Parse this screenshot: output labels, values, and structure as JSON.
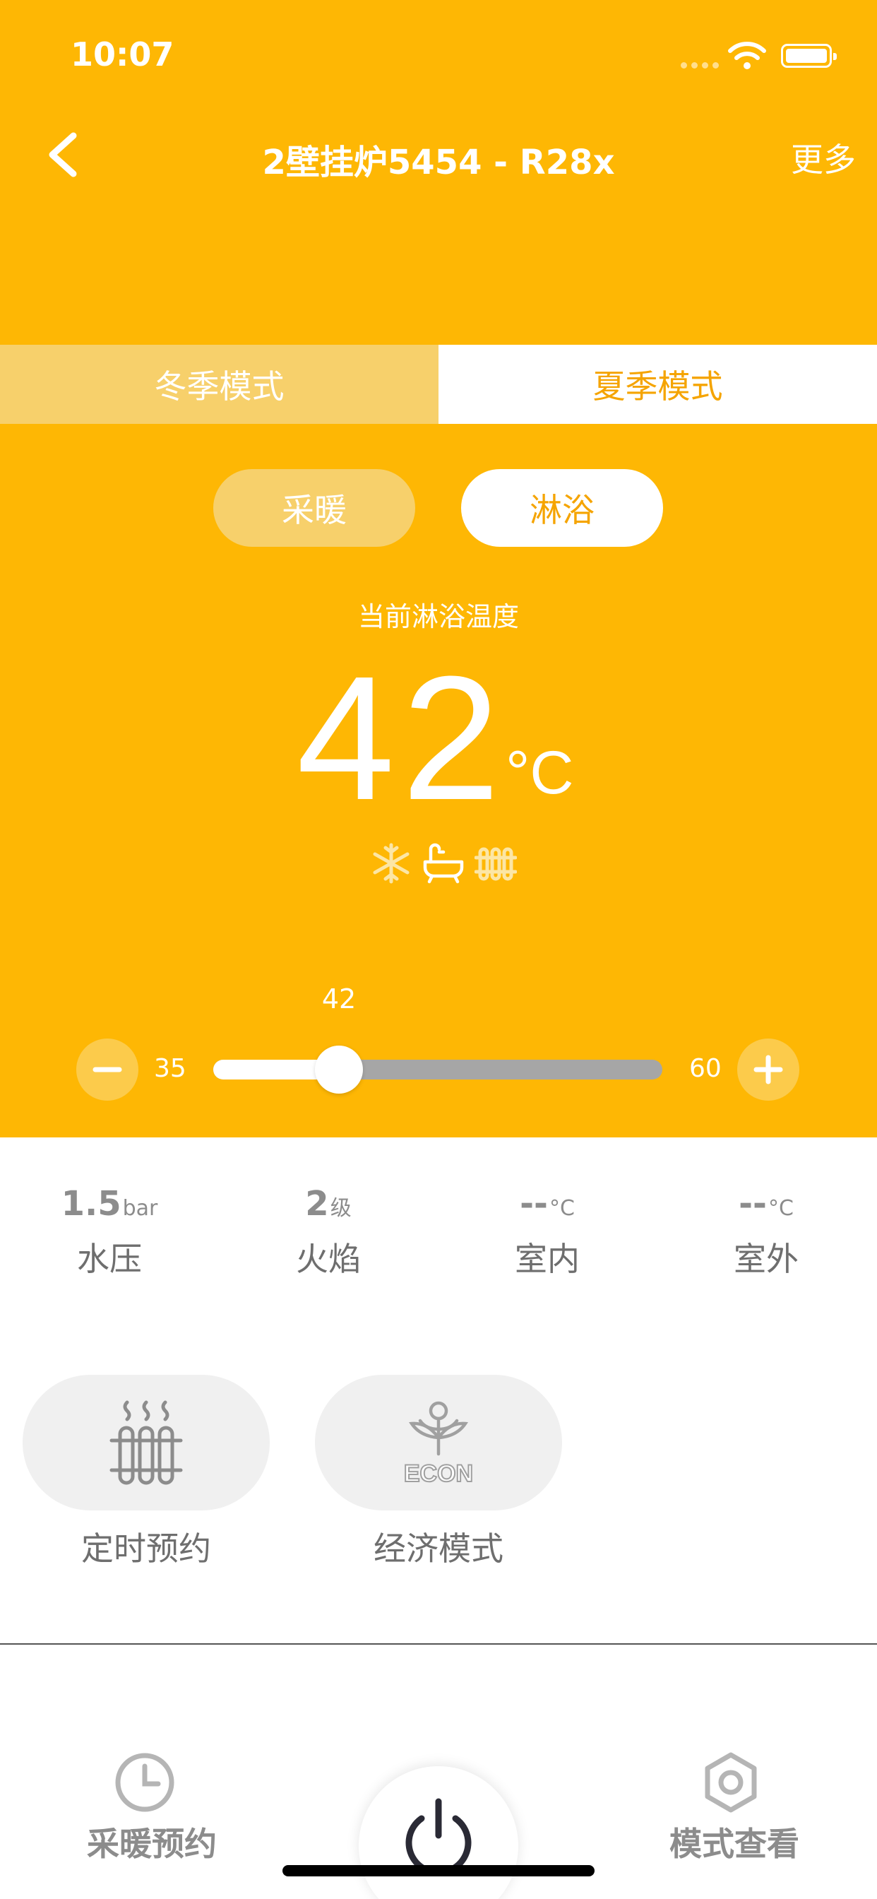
{
  "status_bar": {
    "time": "10:07"
  },
  "nav": {
    "title": "2壁挂炉5454 - R28x",
    "more_label": "更多"
  },
  "season_tabs": {
    "winter": "冬季模式",
    "summer": "夏季模式",
    "selected": "summer"
  },
  "sub_tabs": {
    "heating": "采暖",
    "shower": "淋浴",
    "selected": "shower"
  },
  "current": {
    "label": "当前淋浴温度",
    "value": "42",
    "unit": "°C"
  },
  "mode_icons": [
    "snowflake-icon",
    "bathtub-icon",
    "radiator-icon"
  ],
  "slider": {
    "value": "42",
    "min": "35",
    "max": "60",
    "value_num": 42,
    "min_num": 35,
    "max_num": 60
  },
  "stats": [
    {
      "value": "1.5",
      "unit": "bar",
      "label": "水压"
    },
    {
      "value": "2",
      "unit": "级",
      "label": "火焰"
    },
    {
      "value": "--",
      "unit": "°C",
      "label": "室内"
    },
    {
      "value": "--",
      "unit": "°C",
      "label": "室外"
    }
  ],
  "features": [
    {
      "label": "定时预约",
      "icon": "radiator-steam-icon"
    },
    {
      "label": "经济模式",
      "icon": "econ-icon",
      "icon_text": "ECON"
    }
  ],
  "bottom_nav": {
    "left": "采暖预约",
    "right": "模式查看"
  },
  "colors": {
    "accent": "#FEB704",
    "accent_light": "#F7D06B",
    "orange_text": "#F5A400",
    "gray": "#8C8C8C"
  }
}
